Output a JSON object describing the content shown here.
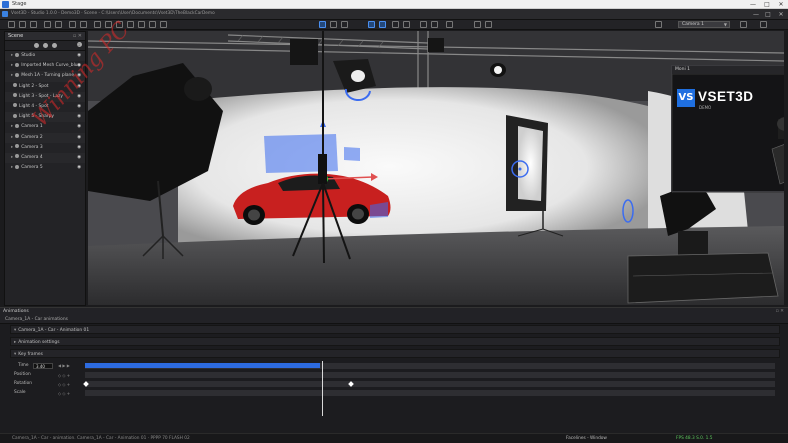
{
  "outer_window": {
    "title": "Stage",
    "controls": [
      "—",
      "□",
      "✕"
    ]
  },
  "main_window": {
    "title": "Vset3D - Studio 1.0.0 - Demo3D · Scene - C:\\Users\\User\\Documents\\Vset3D\\TheBlackCarDemo",
    "controls": [
      "—",
      "□",
      "✕"
    ]
  },
  "toolbar": {
    "camera_select": "Camera 1"
  },
  "scene_panel": {
    "title": "Scene",
    "items": [
      {
        "label": "Studio",
        "arrow": "▸"
      },
      {
        "label": "Imported Mesh Curve_blue",
        "arrow": "▸"
      },
      {
        "label": "Mesh 1A - Turning plane",
        "arrow": "▸"
      },
      {
        "label": "Light 2 - Spot",
        "arrow": ""
      },
      {
        "label": "Light 3 - Spot - Lazy",
        "arrow": ""
      },
      {
        "label": "Light 4 - Spot",
        "arrow": ""
      },
      {
        "label": "Light 5 - Sharpy",
        "arrow": ""
      },
      {
        "label": "Camera 1",
        "arrow": "▸"
      },
      {
        "label": "Camera 2",
        "arrow": "▸"
      },
      {
        "label": "Camera 3",
        "arrow": "▸"
      },
      {
        "label": "Camera 4",
        "arrow": "▸"
      },
      {
        "label": "Camera 5",
        "arrow": "▸"
      }
    ]
  },
  "preview": {
    "title": "Moni 1",
    "logo_mark": "VS",
    "logo_text": "VSET3D",
    "logo_sub": "DEMO"
  },
  "animations": {
    "title": "Animations",
    "subtitle": "Camera_1A - Car animations",
    "animation_name": "Camera_1A - Car - Animation 01",
    "settings_label": "Animation settings",
    "keyframes_label": "Key frames",
    "time_label": "Time",
    "time_value": "3.40",
    "time_progress": 0.34,
    "tracks": [
      "Position",
      "Rotation",
      "Scale"
    ]
  },
  "status": {
    "left": "Camera_1A - Car - animation. Camera_1A - Car - Animation 01 · PPPP 70 FLASH 02",
    "middle": "Facelines - Window",
    "right": "FPS 48.3 S.0. 1.5"
  },
  "watermark": "Winning PC",
  "colors": {
    "accent": "#2d6be0",
    "car": "#d7262a",
    "gizmo_blue": "#3b6cf0",
    "gizmo_green": "#34d23c"
  }
}
